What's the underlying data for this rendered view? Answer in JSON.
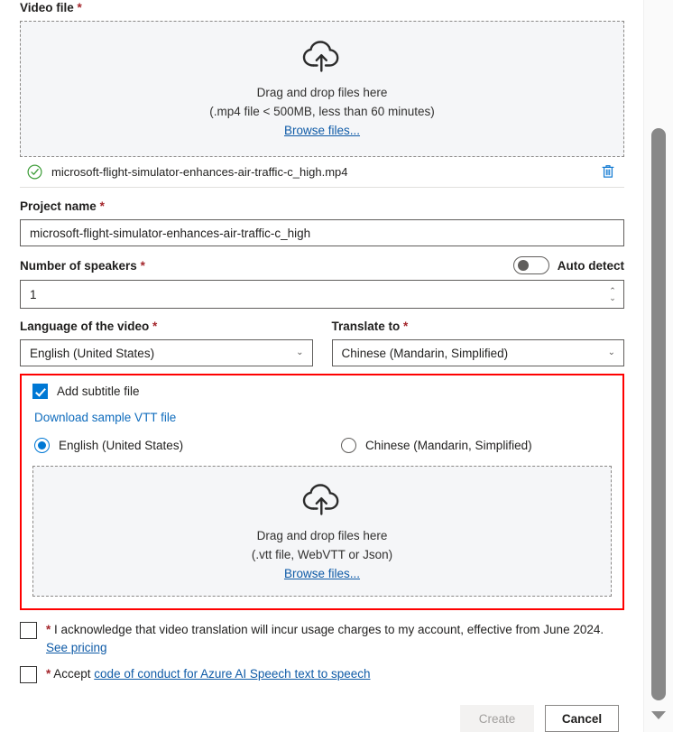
{
  "video_file": {
    "label": "Video file",
    "required_mark": "*",
    "dropzone": {
      "icon": "cloud-upload-icon",
      "line1": "Drag and drop files here",
      "line2": "(.mp4 file < 500MB, less than 60 minutes)",
      "browse": "Browse files..."
    },
    "uploaded": {
      "status_icon": "circle-check-icon",
      "name": "microsoft-flight-simulator-enhances-air-traffic-c_high.mp4",
      "delete_icon": "trash-icon"
    }
  },
  "project_name": {
    "label": "Project name",
    "required_mark": "*",
    "value": "microsoft-flight-simulator-enhances-air-traffic-c_high"
  },
  "speakers": {
    "label": "Number of speakers",
    "required_mark": "*",
    "value": "1",
    "auto_detect_label": "Auto detect",
    "auto_detect_on": false,
    "spin_up": "⌃",
    "spin_down": "⌄"
  },
  "language": {
    "label": "Language of the video",
    "required_mark": "*",
    "value": "English (United States)",
    "chevron": "⌄"
  },
  "translate_to": {
    "label": "Translate to",
    "required_mark": "*",
    "value": "Chinese (Mandarin, Simplified)",
    "chevron": "⌄"
  },
  "subtitle": {
    "highlight_color": "#ff0000",
    "checkbox_label": "Add subtitle file",
    "checkbox_checked": true,
    "download_link": "Download sample VTT file",
    "radios": [
      {
        "label": "English (United States)",
        "selected": true
      },
      {
        "label": "Chinese (Mandarin, Simplified)",
        "selected": false
      }
    ],
    "dropzone": {
      "icon": "cloud-upload-icon",
      "line1": "Drag and drop files here",
      "line2": "(.vtt file, WebVTT or Json)",
      "browse": "Browse files..."
    }
  },
  "consent": {
    "acknowledge": {
      "required_mark": "*",
      "text": " I acknowledge that video translation will incur usage charges to my account, effective from June 2024.",
      "link": "See pricing",
      "checked": false
    },
    "accept": {
      "required_mark": "*",
      "prefix": " Accept ",
      "link": "code of conduct for Azure AI Speech text to speech",
      "checked": false
    }
  },
  "footer": {
    "create_label": "Create",
    "cancel_label": "Cancel",
    "create_disabled": true
  },
  "scrollbar": {
    "name": "vertical-scrollbar",
    "thumb_color": "#888888"
  }
}
